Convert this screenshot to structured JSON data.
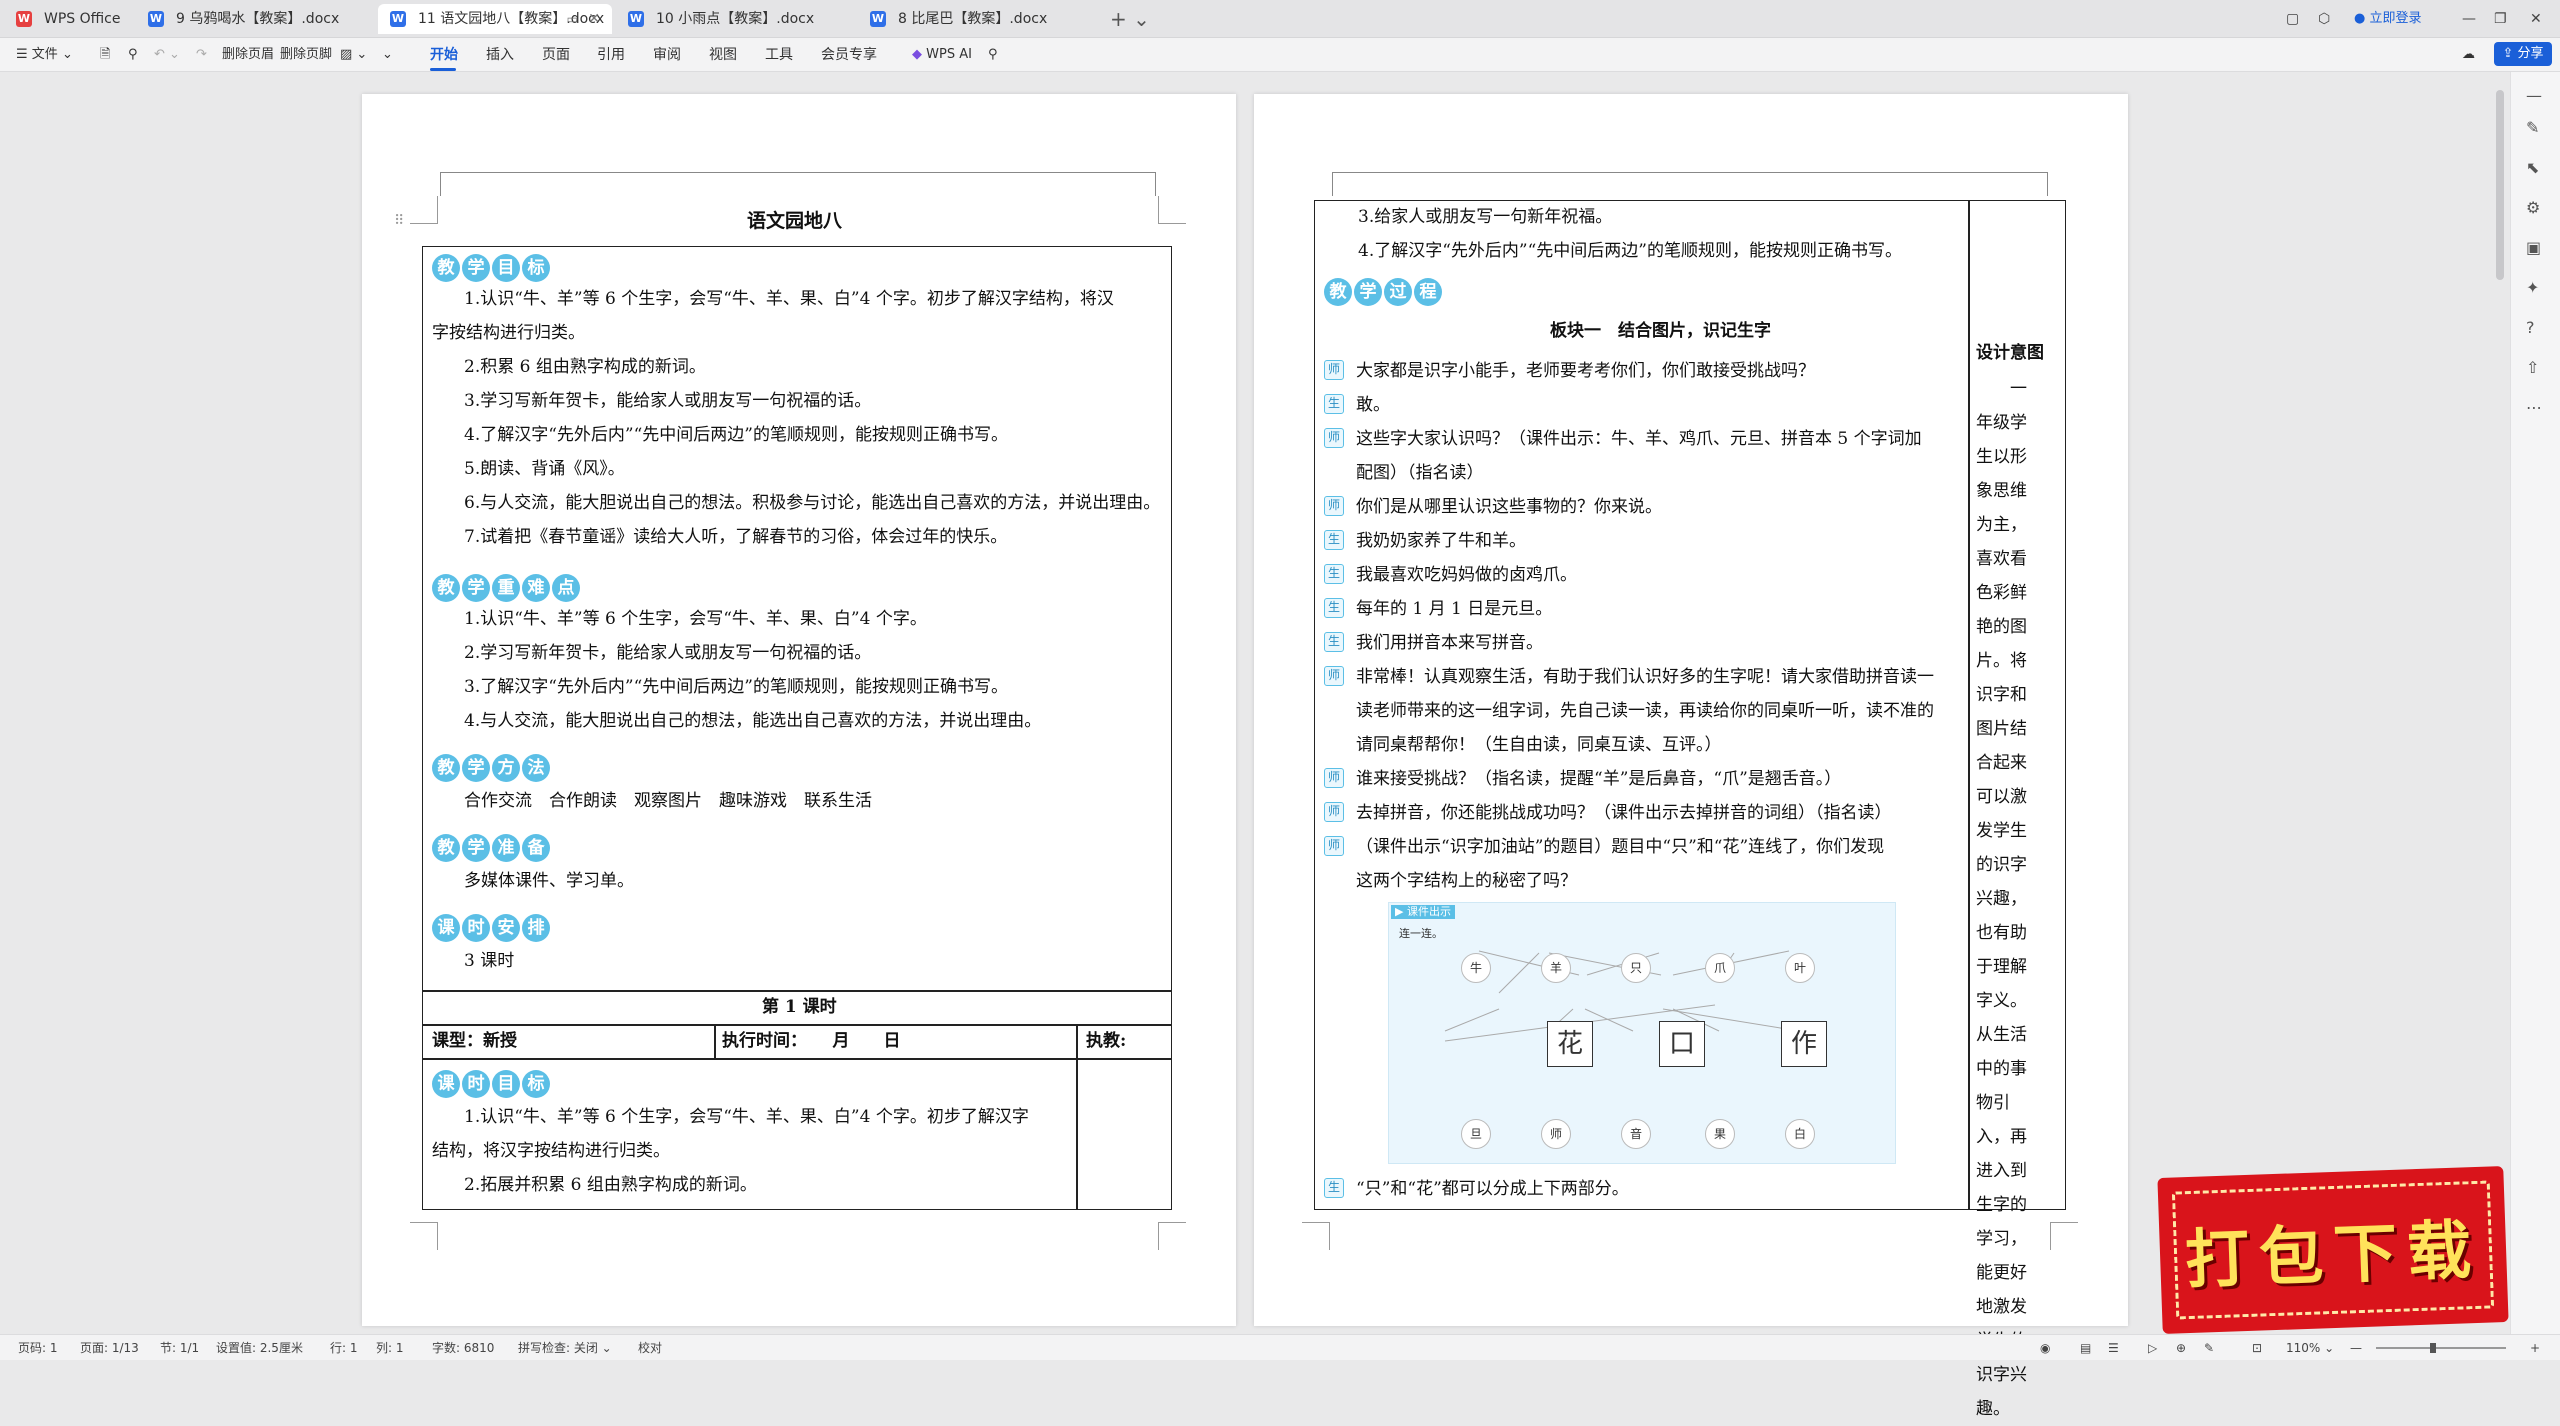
{
  "tabs": [
    {
      "label": "WPS Office",
      "icon": "wps-logo-icon"
    },
    {
      "label": "9 乌鸦喝水【教案】.docx",
      "icon": "word-doc-icon"
    },
    {
      "label": "11 语文园地八【教案】.docx",
      "icon": "word-doc-icon"
    },
    {
      "label": "10 小雨点【教案】.docx",
      "icon": "word-doc-icon"
    },
    {
      "label": "8 比尾巴【教案】.docx",
      "icon": "word-doc-icon"
    }
  ],
  "login_label": "立即登录",
  "toolbar": {
    "file": "文件",
    "delete_header": "删除页眉",
    "delete_footer": "删除页脚",
    "menus": [
      "开始",
      "插入",
      "页面",
      "引用",
      "审阅",
      "视图",
      "工具",
      "会员专享"
    ],
    "wps_ai": "WPS AI",
    "share": "分享"
  },
  "left": {
    "title": "语文园地八",
    "sec1_badge": "教学目标",
    "goals": [
      "1.认识“牛、羊”等 6 个生字，会写“牛、羊、果、白”4 个字。初步了解汉字结构，将汉",
      "字按结构进行归类。",
      "2.积累 6 组由熟字构成的新词。",
      "3.学习写新年贺卡，能给家人或朋友写一句祝福的话。",
      "4.了解汉字“先外后内”“先中间后两边”的笔顺规则，能按规则正确书写。",
      "5.朗读、背诵《风》。",
      "6.与人交流，能大胆说出自己的想法。积极参与讨论，能选出自己喜欢的方法，并说出理由。",
      "7.试着把《春节童谣》读给大人听，了解春节的习俗，体会过年的快乐。"
    ],
    "sec2_badge": "教学重难点",
    "keys": [
      "1.认识“牛、羊”等 6 个生字，会写“牛、羊、果、白”4 个字。",
      "2.学习写新年贺卡，能给家人或朋友写一句祝福的话。",
      "3.了解汉字“先外后内”“先中间后两边”的笔顺规则，能按规则正确书写。",
      "4.与人交流，能大胆说出自己的想法，能选出自己喜欢的方法，并说出理由。"
    ],
    "sec3_badge": "教学方法",
    "methods": "合作交流　合作朗读　观察图片　趣味游戏　联系生活",
    "sec4_badge": "教学准备",
    "prep": "多媒体课件、学习单。",
    "sec5_badge": "课时安排",
    "hours": "3 课时",
    "lesson1": "第 1 课时",
    "type_label": "课型：新授",
    "exec_label": "执行时间：　　月　　日",
    "teacher_label": "执教:",
    "sec6_badge": "课时目标",
    "lesson_goals": [
      "1.认识“牛、羊”等 6 个生字，会写“牛、羊、果、白”4 个字。初步了解汉字",
      "结构，将汉字按结构进行归类。",
      "2.拓展并积累 6 组由熟字构成的新词。"
    ]
  },
  "right": {
    "top_lines": [
      "3.给家人或朋友写一句新年祝福。",
      "4.了解汉字“先外后内”“先中间后两边”的笔顺规则，能按规则正确书写。"
    ],
    "process_badge": "教学过程",
    "block_title": "板块一　结合图片，识记生字",
    "dialog": [
      {
        "role": "师",
        "text": "大家都是识字小能手，老师要考考你们，你们敢接受挑战吗？"
      },
      {
        "role": "生",
        "text": "敢。"
      },
      {
        "role": "师",
        "text": "这些字大家认识吗？（课件出示：牛、羊、鸡爪、元旦、拼音本 5 个字词加"
      },
      {
        "role": "",
        "text": "配图）（指名读）"
      },
      {
        "role": "师",
        "text": "你们是从哪里认识这些事物的？你来说。"
      },
      {
        "role": "生",
        "text": "我奶奶家养了牛和羊。"
      },
      {
        "role": "生",
        "text": "我最喜欢吃妈妈做的卤鸡爪。"
      },
      {
        "role": "生",
        "text": "每年的 1 月 1 日是元旦。"
      },
      {
        "role": "生",
        "text": "我们用拼音本来写拼音。"
      },
      {
        "role": "师",
        "text": "非常棒！认真观察生活，有助于我们认识好多的生字呢！请大家借助拼音读一"
      },
      {
        "role": "",
        "text": "读老师带来的这一组字词，先自己读一读，再读给你的同桌听一听，读不准的"
      },
      {
        "role": "",
        "text": "请同桌帮帮你！（生自由读，同桌互读、互评。）"
      },
      {
        "role": "师",
        "text": "谁来接受挑战？（指名读，提醒“羊”是后鼻音，“爪”是翘舌音。）"
      },
      {
        "role": "师",
        "text": "去掉拼音，你还能挑战成功吗？（课件出示去掉拼音的词组）（指名读）"
      },
      {
        "role": "师",
        "text": "（课件出示“识字加油站”的题目）题目中“只”和“花”连线了，你们发现"
      },
      {
        "role": "",
        "text": "这两个字结构上的秘密了吗？"
      }
    ],
    "last_line": {
      "role": "生",
      "text": "“只”和“花”都可以分成上下两部分。"
    },
    "design_title": "设计意图",
    "design_text": "一年级学生以形象思维为主，喜欢看色彩鲜艳的图片。将识字和图片结合起来可以激发学生的识字兴趣，也有助于理解字义。从生活中的事物引入，再进入到生字的学习，能更好地激发学生的识字兴趣。",
    "figure": {
      "label": "课件出示",
      "sub": "连一连。",
      "top_chars": [
        "牛",
        "羊",
        "只",
        "爪",
        "叶"
      ],
      "mid_chars": [
        "花",
        "口",
        "作"
      ],
      "bottom_chars": [
        "旦",
        "师",
        "音",
        "果",
        "白"
      ]
    }
  },
  "status": {
    "page": "页码: 1",
    "pages": "页面: 1/13",
    "section": "节: 1/1",
    "setting": "设置值: 2.5厘米",
    "row": "行: 1",
    "col": "列: 1",
    "words": "字数: 6810",
    "spell": "拼写检查: 关闭",
    "proof": "校对",
    "zoom": "110%"
  },
  "promo": "打包下载"
}
